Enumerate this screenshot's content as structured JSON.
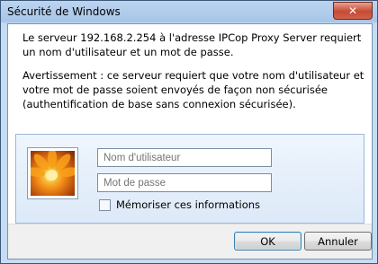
{
  "window": {
    "title": "Sécurité de Windows",
    "close_label": "✕"
  },
  "message": {
    "intro": "Le serveur 192.168.2.254 à l'adresse IPCop Proxy Server requiert un nom d'utilisateur et un mot de passe.",
    "warning": "Avertissement : ce serveur requiert que votre nom d'utilisateur et votre mot de passe soient envoyés de façon non sécurisée (authentification de base sans connexion sécurisée)."
  },
  "credentials": {
    "username_placeholder": "Nom d'utilisateur",
    "password_placeholder": "Mot de passe",
    "remember_label": "Mémoriser ces informations",
    "remember_checked": false
  },
  "buttons": {
    "ok": "OK",
    "cancel": "Annuler"
  },
  "colors": {
    "accent": "#3c7fb1",
    "titlebar": "#a7c5e8",
    "close": "#c74a33"
  }
}
